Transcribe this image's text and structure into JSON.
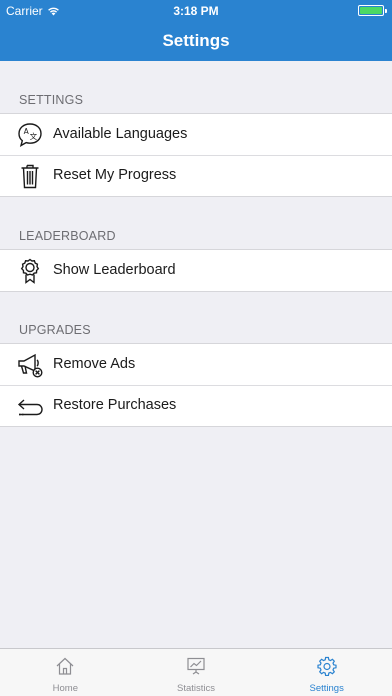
{
  "status": {
    "carrier": "Carrier",
    "time": "3:18 PM"
  },
  "nav": {
    "title": "Settings"
  },
  "sections": [
    {
      "header": "SETTINGS",
      "items": [
        {
          "label": "Available Languages",
          "icon": "translate-icon"
        },
        {
          "label": "Reset My Progress",
          "icon": "trash-icon"
        }
      ]
    },
    {
      "header": "LEADERBOARD",
      "items": [
        {
          "label": "Show Leaderboard",
          "icon": "award-ribbon-icon"
        }
      ]
    },
    {
      "header": "UPGRADES",
      "items": [
        {
          "label": "Remove Ads",
          "icon": "megaphone-off-icon"
        },
        {
          "label": "Restore Purchases",
          "icon": "restore-arrow-icon"
        }
      ]
    }
  ],
  "tabbar": {
    "tabs": [
      {
        "label": "Home",
        "icon": "home-icon",
        "active": false
      },
      {
        "label": "Statistics",
        "icon": "statistics-icon",
        "active": false
      },
      {
        "label": "Settings",
        "icon": "gear-icon",
        "active": true
      }
    ]
  },
  "colors": {
    "accent": "#2a83d0",
    "battery": "#4cd964"
  }
}
